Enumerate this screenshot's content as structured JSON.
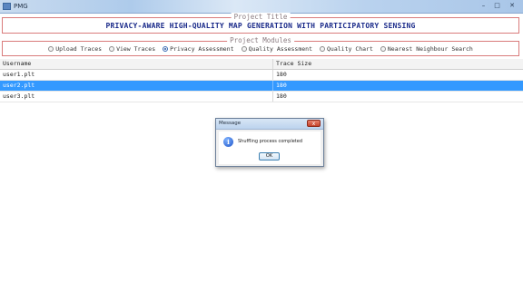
{
  "window": {
    "title": "PMG",
    "controls": {
      "minimize": "–",
      "maximize": "□",
      "close": "✕"
    }
  },
  "project_title": {
    "legend": "Project Title",
    "heading": "PRIVACY-AWARE HIGH-QUALITY MAP GENERATION WITH PARTICIPATORY SENSING"
  },
  "modules": {
    "legend": "Project Modules",
    "options": [
      {
        "label": "Upload Traces",
        "selected": false
      },
      {
        "label": "View Traces",
        "selected": false
      },
      {
        "label": "Privacy Assessment",
        "selected": true
      },
      {
        "label": "Quality Assessment",
        "selected": false
      },
      {
        "label": "Quality Chart",
        "selected": false
      },
      {
        "label": "Nearest Neighbour Search",
        "selected": false
      }
    ]
  },
  "table": {
    "headers": [
      "Username",
      "Trace Size"
    ],
    "rows": [
      {
        "username": "user1.plt",
        "trace_size": "180",
        "selected": false
      },
      {
        "username": "user2.plt",
        "trace_size": "180",
        "selected": true
      },
      {
        "username": "user3.plt",
        "trace_size": "180",
        "selected": false
      }
    ]
  },
  "dialog": {
    "title": "Message",
    "close": "x",
    "message": "Shuffling process completed",
    "ok_label": "OK",
    "icon": "info-icon"
  }
}
